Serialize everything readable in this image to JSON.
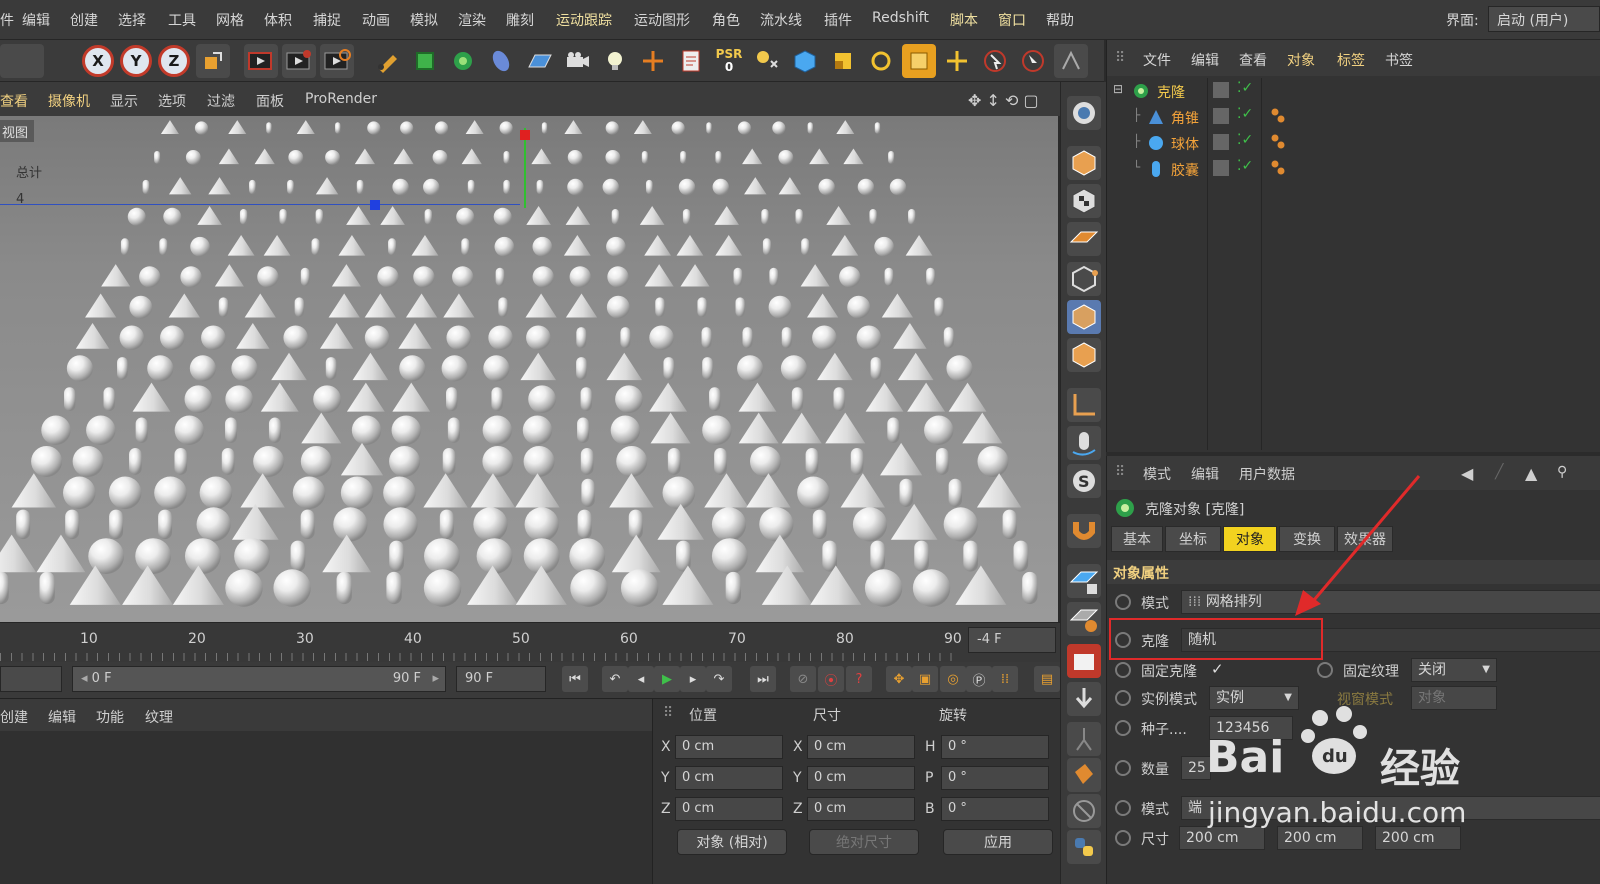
{
  "menubar": {
    "items": [
      "件",
      "编辑",
      "创建",
      "选择",
      "工具",
      "网格",
      "体积",
      "捕捉",
      "动画",
      "模拟",
      "渲染",
      "雕刻",
      "运动跟踪",
      "运动图形",
      "角色",
      "流水线",
      "插件",
      "Redshift",
      "脚本",
      "窗口",
      "帮助"
    ],
    "layout_label": "界面:",
    "layout_value": "启动 (用户)"
  },
  "toolbar": {
    "axis_x": "X",
    "axis_y": "Y",
    "axis_z": "Z",
    "psr_label": "PSR",
    "psr_value": "0"
  },
  "viewport": {
    "menu": [
      "查看",
      "摄像机",
      "显示",
      "选项",
      "过滤",
      "面板",
      "ProRender"
    ],
    "view_label": "视图",
    "stats_label": "总计",
    "stats_value": "4"
  },
  "object_manager": {
    "menu": [
      "文件",
      "编辑",
      "查看",
      "对象",
      "标签",
      "书签"
    ],
    "objects": [
      {
        "name": "克隆",
        "icon": "cloner-icon",
        "color": "#f2c94c"
      },
      {
        "name": "角锥",
        "icon": "cone-icon",
        "color": "#f2a23a"
      },
      {
        "name": "球体",
        "icon": "sphere-icon",
        "color": "#f2a23a"
      },
      {
        "name": "胶囊",
        "icon": "capsule-icon",
        "color": "#f2a23a"
      }
    ]
  },
  "attributes": {
    "menu": [
      "模式",
      "编辑",
      "用户数据"
    ],
    "object_title": "克隆对象 [克隆]",
    "tabs": [
      "基本",
      "坐标",
      "对象",
      "变换",
      "效果器"
    ],
    "active_tab": "对象",
    "section_title": "对象属性",
    "mode_label": "模式",
    "mode_value": "网格排列",
    "clone_label": "克隆",
    "clone_value": "随机",
    "fixed_clone_label": "固定克隆",
    "fixed_clone_check": "✓",
    "fixed_texture_label": "固定纹理",
    "fixed_texture_value": "关闭",
    "instance_mode_label": "实例模式",
    "instance_mode_value": "实例",
    "viewport_mode_label": "视窗模式",
    "viewport_mode_value": "对象",
    "seed_label": "种子....",
    "seed_value": "123456",
    "count_label": "数量",
    "count_value": "25",
    "mode2_label": "模式",
    "mode2_value": "端",
    "size_label": "尺寸",
    "size_x": "200 cm",
    "size_y": "200 cm",
    "size_z": "200 cm"
  },
  "timeline": {
    "ticks": [
      "10",
      "20",
      "30",
      "40",
      "50",
      "60",
      "70",
      "80",
      "90"
    ],
    "current_frame": "-4 F"
  },
  "playbar": {
    "start_field": "0 F",
    "range_end": "90 F",
    "end_field": "90 F"
  },
  "material_manager": {
    "menu": [
      "创建",
      "编辑",
      "功能",
      "纹理"
    ]
  },
  "coordinates": {
    "headers": [
      "位置",
      "尺寸",
      "旋转"
    ],
    "pos": [
      {
        "axis": "X",
        "value": "0 cm"
      },
      {
        "axis": "Y",
        "value": "0 cm"
      },
      {
        "axis": "Z",
        "value": "0 cm"
      }
    ],
    "size": [
      {
        "axis": "X",
        "value": "0 cm"
      },
      {
        "axis": "Y",
        "value": "0 cm"
      },
      {
        "axis": "Z",
        "value": "0 cm"
      }
    ],
    "rot": [
      {
        "axis": "H",
        "value": "0 °"
      },
      {
        "axis": "P",
        "value": "0 °"
      },
      {
        "axis": "B",
        "value": "0 °"
      }
    ],
    "mode_value": "对象 (相对)",
    "size_mode_value": "绝对尺寸",
    "apply_label": "应用"
  },
  "watermark": {
    "brand": "Bai",
    "brand_suffix": "经验",
    "url": "jingyan.baidu.com"
  },
  "colors": {
    "accent_tab": "#f2d21f",
    "highlight_box": "#e02a2a",
    "arrow": "#e02a2a"
  }
}
